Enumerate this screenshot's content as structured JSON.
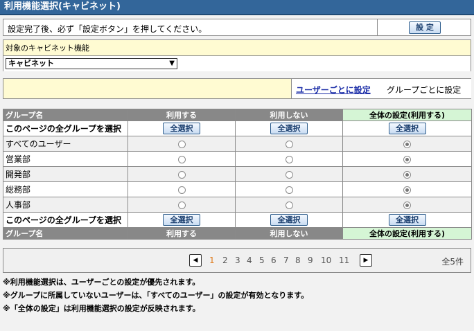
{
  "title": "利用機能選択(キャビネット)",
  "instruction": {
    "text": "設定完了後、必ず「設定ボタン」を押してください。",
    "set_button": "設 定"
  },
  "cabinet": {
    "label": "対象のキャビネット機能",
    "selected": "キャビネット"
  },
  "mode": {
    "per_user_link": "ユーザーごとに設定",
    "per_group_label": "グループごとに設定"
  },
  "table": {
    "headers": [
      "グループ名",
      "利用する",
      "利用しない",
      "全体の設定(利用する)"
    ],
    "select_all_row": {
      "label": "このページの全グループを選択",
      "button": "全選択"
    },
    "rows": [
      {
        "name": "すべてのユーザー",
        "choice": "all"
      },
      {
        "name": "営業部",
        "choice": "all"
      },
      {
        "name": "開発部",
        "choice": "all"
      },
      {
        "name": "総務部",
        "choice": "all"
      },
      {
        "name": "人事部",
        "choice": "all"
      }
    ]
  },
  "pager": {
    "prev_icon": "prev-arrow-icon",
    "next_icon": "next-arrow-icon",
    "pages": [
      "1",
      "2",
      "3",
      "4",
      "5",
      "6",
      "7",
      "8",
      "9",
      "10",
      "11"
    ],
    "current": "1",
    "total": "全5件"
  },
  "notes": [
    "※利用機能選択は、ユーザーごとの設定が優先されます。",
    "※グループに所属していないユーザーは、「すべてのユーザー」の設定が有効となります。",
    "※「全体の設定」は利用機能選択の設定が反映されます。"
  ]
}
